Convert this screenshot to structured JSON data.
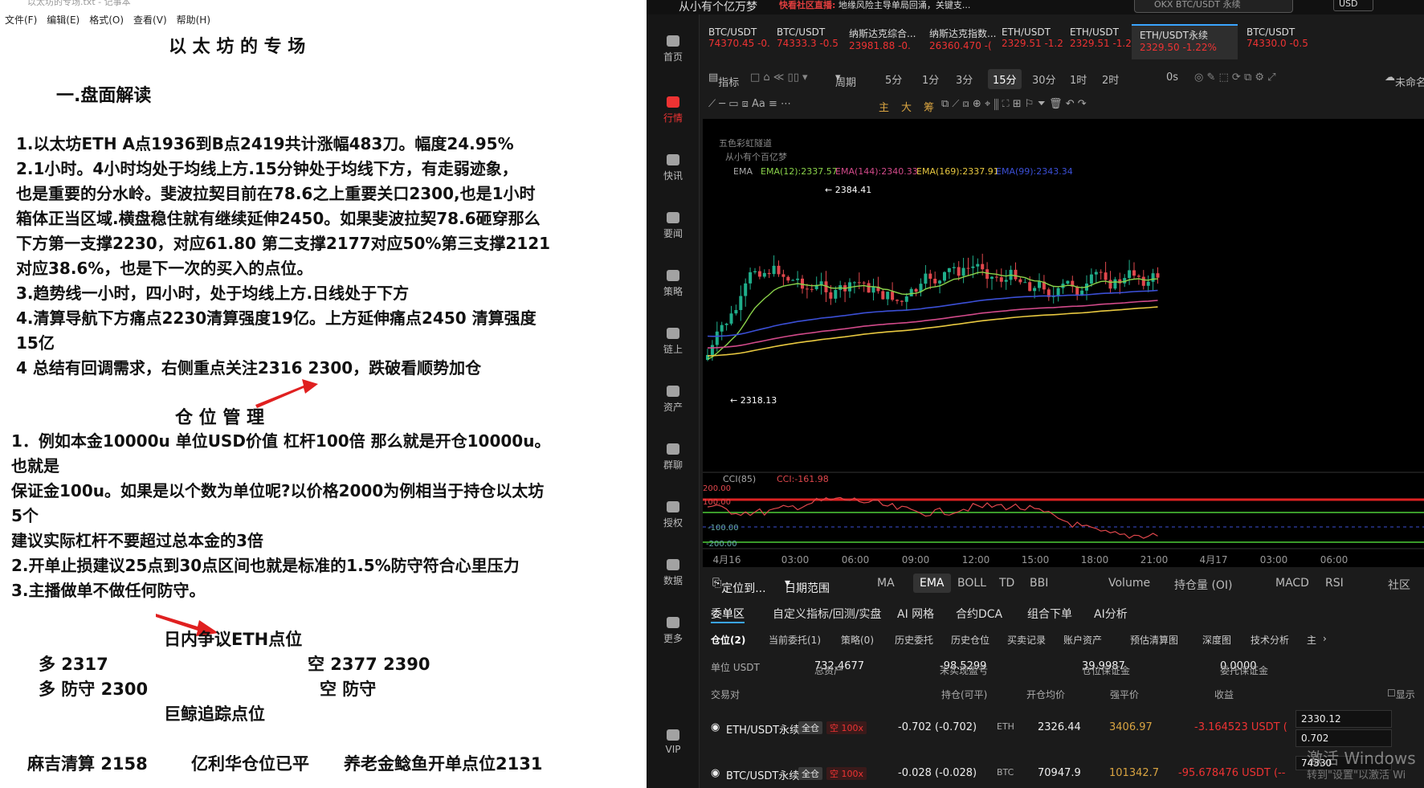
{
  "notepad": {
    "title": "以太坊的专场.txt - 记事本",
    "menu": [
      "文件(F)",
      "编辑(E)",
      "格式(O)",
      "查看(V)",
      "帮助(H)"
    ],
    "lines": [
      "以 太 坊 的 专 场",
      "一.盘面解读",
      "1.以太坊ETH A点1936到B点2419共计涨幅483刀。幅度24.95%",
      "2.1小时。4小时均处于均线上方.15分钟处于均线下方，有走弱迹象，",
      "也是重要的分水岭。斐波拉契目前在78.6之上重要关口2300,也是1小时",
      "箱体正当区域.横盘稳住就有继续延伸2450。如果斐波拉契78.6砸穿那么",
      "下方第一支撑2230，对应61.80 第二支撑2177对应50%第三支撑2121",
      "对应38.6%，也是下一次的买入的点位。",
      "3.趋势线一小时，四小时，处于均线上方.日线处于下方",
      "4.清算导航下方痛点2230清算强度19亿。上方延伸痛点2450 清算强度",
      "15亿",
      "4 总结有回调需求，右侧重点关注2316  2300，跌破看顺势加仓",
      "仓  位    管    理",
      "1．例如本金10000u 单位USD价值  杠杆100倍 那么就是开仓10000u。",
      "也就是",
      "保证金100u。如果是以个数为单位呢?以价格2000为例相当于持仓以太坊",
      "5个",
      "建议实际杠杆不要超过总本金的3倍",
      "2.开单止损建议25点到30点区间也就是标准的1.5%防守符合心里压力",
      "3.主播做单不做任何防守。",
      "日内争议ETH点位",
      "多    2317",
      "空 2377  2390",
      "多 防守 2300",
      "空  防守",
      "巨鲸追踪点位",
      "麻吉清算 2158",
      "亿利华仓位已平",
      "养老金鲶鱼开单点位2131"
    ]
  },
  "app": {
    "name": "从小有个亿万梦",
    "news_prefix": "快看社区直播:",
    "news": "地缘风险主导单局回涌，关键支...",
    "search_placeholder": "OKX BTC/USDT 永续",
    "currency": "USD"
  },
  "sidebar": [
    {
      "label": "首页",
      "icon": "home-icon"
    },
    {
      "label": "行情",
      "icon": "market-chart-icon"
    },
    {
      "label": "快讯",
      "icon": "flash-news-icon"
    },
    {
      "label": "要闻",
      "icon": "headline-icon"
    },
    {
      "label": "策略",
      "icon": "strategy-robot-icon"
    },
    {
      "label": "链上",
      "icon": "onchain-icon"
    },
    {
      "label": "资产",
      "icon": "wallet-icon"
    },
    {
      "label": "群聊",
      "icon": "chat-icon"
    },
    {
      "label": "授权",
      "icon": "key-icon"
    },
    {
      "label": "数据",
      "icon": "data-icon"
    },
    {
      "label": "更多",
      "icon": "more-grid-icon"
    },
    {
      "label": "VIP",
      "icon": "vip-icon"
    }
  ],
  "tabs": [
    {
      "name": "BTC/USDT",
      "price": "74370.45 -0."
    },
    {
      "name": "BTC/USDT",
      "price": "74333.3 -0.5"
    },
    {
      "name": "纳斯达克综合...",
      "price": "23981.88 -0."
    },
    {
      "name": "纳斯达克指数...",
      "price": "26360.470 -("
    },
    {
      "name": "ETH/USDT",
      "price": "2329.51 -1.2"
    },
    {
      "name": "ETH/USDT",
      "price": "2329.51 -1.2"
    },
    {
      "name": "ETH/USDT永续",
      "price": "2329.50 -1.22%"
    },
    {
      "name": "BTC/USDT",
      "price": "74330.0 -0.5"
    }
  ],
  "toolbar": {
    "indicators": "指标",
    "period": "周期",
    "intervals": [
      "5分",
      "1分",
      "3分",
      "15分",
      "30分",
      "1时",
      "2时"
    ],
    "seconds": "0s",
    "unnamed": "未命名"
  },
  "drawing_tools": [
    "主",
    "大",
    "筹"
  ],
  "chart": {
    "legend_title": "五色彩虹隧道",
    "legend_sub": "从小有个百亿梦",
    "ema_label": "EMA",
    "ema_values": [
      {
        "text": "EMA(12):2337.57",
        "color": "#8ad24a"
      },
      {
        "text": "EMA(144):2340.33",
        "color": "#d24a8a"
      },
      {
        "text": "EMA(169):2337.91",
        "color": "#e8c840"
      },
      {
        "text": "EMA(99):2343.34",
        "color": "#3b4fd6"
      }
    ],
    "high_label": "← 2384.41",
    "low_label": "← 2318.13",
    "cci_label": "CCI(85)",
    "cci_value": "CCI:-161.98",
    "cci_levels": [
      "200.00",
      "100.00",
      "-100.00",
      "-200.00"
    ],
    "x_ticks": [
      "4月16",
      "03:00",
      "06:00",
      "09:00",
      "12:00",
      "15:00",
      "18:00",
      "21:00",
      "4月17",
      "03:00",
      "06:00"
    ]
  },
  "chart_bottom_tabs": [
    "定位到...",
    "日期范围",
    "MA",
    "EMA",
    "BOLL",
    "TD",
    "BBI",
    "Volume",
    "持仓量 (OI)",
    "MACD",
    "RSI",
    "社区"
  ],
  "order_tabs": [
    "委单区",
    "自定义指标/回测/实盘",
    "AI 网格",
    "合约DCA",
    "组合下单",
    "AI分析"
  ],
  "position_tabs": [
    "仓位(2)",
    "当前委托(1)",
    "策略(0)",
    "历史委托",
    "历史仓位",
    "买卖记录",
    "账户资产",
    "预估清算图",
    "深度图",
    "技术分析",
    "主"
  ],
  "summary": {
    "unit": "单位 USDT",
    "total_label": "总资产",
    "total": "732.4677",
    "pnl_label": "未实现盈亏",
    "pnl": "-98.5299",
    "margin_label": "仓位保证金",
    "margin": "39.9987",
    "order_margin_label": "委托保证金",
    "order_margin": "0.0000"
  },
  "position_headers": [
    "交易对",
    "持仓(可平)",
    "开仓均价",
    "强平价",
    "收益",
    "显示"
  ],
  "positions": [
    {
      "pair": "ETH/USDT永续",
      "mode": "全仓",
      "lev": "空 100x",
      "qty": "-0.702 (-0.702)",
      "unit": "ETH",
      "entry": "2326.44",
      "liq": "3406.97",
      "pnl": "-3.164523 USDT ("
    },
    {
      "pair": "BTC/USDT永续",
      "mode": "全仓",
      "lev": "空 100x",
      "qty": "-0.028 (-0.028)",
      "unit": "BTC",
      "entry": "70947.9",
      "liq": "101342.7",
      "pnl": "-95.678476 USDT (--"
    }
  ],
  "inputs": [
    "2330.12",
    "0.702",
    "74330"
  ],
  "watermark": "激活 Windows",
  "watermark_sub": "转到\"设置\"以激活 Wi",
  "colors": {
    "up": "#1fae8b",
    "down": "#e0474c",
    "accent": "#3aa5ff"
  }
}
